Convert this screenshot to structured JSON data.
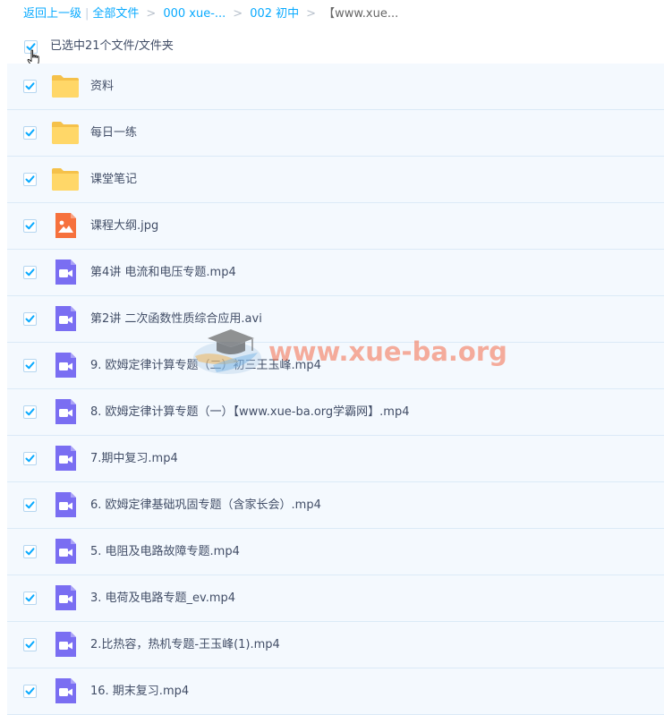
{
  "breadcrumb": {
    "back_label": "返回上一级",
    "all_files_label": "全部文件",
    "crumb1": "000 xue-...",
    "crumb2": "002 初中",
    "current": "【www.xue...",
    "separator": ">"
  },
  "selection": {
    "text": "已选中21个文件/文件夹"
  },
  "files": [
    {
      "name": "资料",
      "type": "folder"
    },
    {
      "name": "每日一练",
      "type": "folder"
    },
    {
      "name": "课堂笔记",
      "type": "folder"
    },
    {
      "name": "课程大纲.jpg",
      "type": "image"
    },
    {
      "name": "第4讲 电流和电压专题.mp4",
      "type": "video"
    },
    {
      "name": "第2讲 二次函数性质综合应用.avi",
      "type": "video"
    },
    {
      "name": "9. 欧姆定律计算专题（二）初三王玉峰.mp4",
      "type": "video"
    },
    {
      "name": "8. 欧姆定律计算专题（一）【www.xue-ba.org学霸网】.mp4",
      "type": "video"
    },
    {
      "name": "7.期中复习.mp4",
      "type": "video"
    },
    {
      "name": "6. 欧姆定律基础巩固专题（含家长会）.mp4",
      "type": "video"
    },
    {
      "name": "5. 电阻及电路故障专题.mp4",
      "type": "video"
    },
    {
      "name": "3. 电荷及电路专题_ev.mp4",
      "type": "video"
    },
    {
      "name": "2.比热容，热机专题-王玉峰(1).mp4",
      "type": "video"
    },
    {
      "name": "16. 期末复习.mp4",
      "type": "video"
    }
  ],
  "watermark": {
    "text": "www.xue-ba.org"
  },
  "colors": {
    "link": "#09aaff",
    "check": "#09aaff",
    "folder": "#ffd768",
    "image_icon": "#f6713d",
    "video_icon": "#7a6ef2",
    "row_bg": "#f4f9fe"
  }
}
